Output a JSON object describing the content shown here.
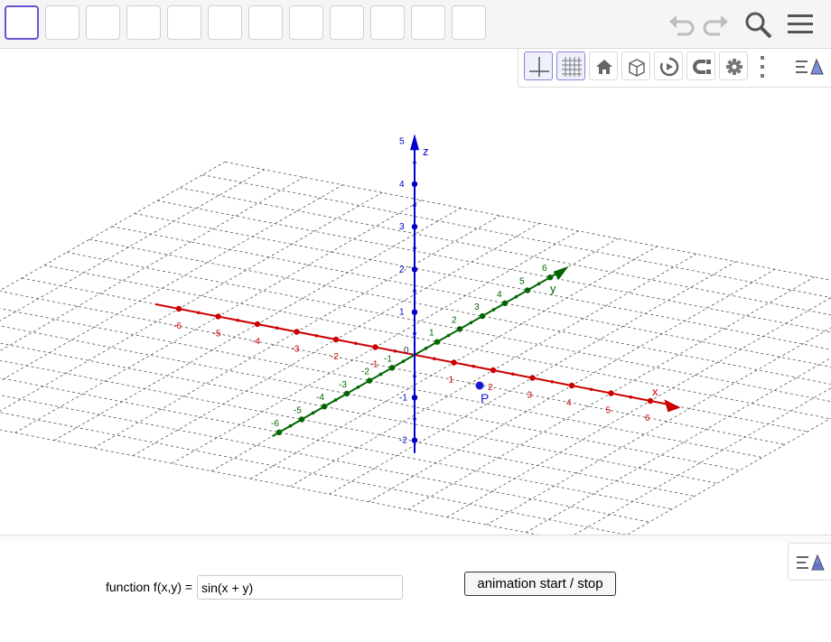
{
  "toolbar": {
    "tools": [
      "move-tool",
      "tool-2",
      "tool-3",
      "tool-4",
      "tool-5",
      "tool-6",
      "tool-7",
      "tool-8",
      "tool-9",
      "tool-10",
      "tool-11",
      "tool-12"
    ],
    "undo_icon": "undo-icon",
    "redo_icon": "redo-icon",
    "search_icon": "search-icon",
    "menu_icon": "hamburger-menu-icon"
  },
  "style_bar": {
    "buttons": [
      "axes-icon",
      "grid-icon",
      "home-icon",
      "view-cube-icon",
      "rotate-view-icon",
      "projection-icon",
      "settings-gear-icon",
      "more-vertical-icon",
      "toggle-style-bar-icon"
    ]
  },
  "graph": {
    "x_axis_label": "x",
    "y_axis_label": "y",
    "z_axis_label": "z",
    "point_label": "P",
    "origin_label": "0",
    "x_ticks": [
      "-6",
      "-5",
      "-4",
      "-3",
      "-2",
      "-1",
      "1",
      "2",
      "3",
      "4",
      "5",
      "6"
    ],
    "y_ticks": [
      "-6",
      "-5",
      "-4",
      "-3",
      "-2",
      "-1",
      "1",
      "2",
      "3",
      "4",
      "5",
      "6"
    ],
    "z_ticks": [
      "-2",
      "-1",
      "1",
      "2",
      "3",
      "4",
      "5"
    ],
    "colors": {
      "x_axis": "#cc0000",
      "y_axis": "#006600",
      "z_axis": "#0000cc",
      "grid": "#555555",
      "point": "#1a1ad6"
    }
  },
  "panel": {
    "function_label": "function f(x,y) =",
    "function_value": "sin(x + y)",
    "animation_button_label": "animation start / stop",
    "side_toggle_icon": "toggle-style-bar-icon"
  }
}
